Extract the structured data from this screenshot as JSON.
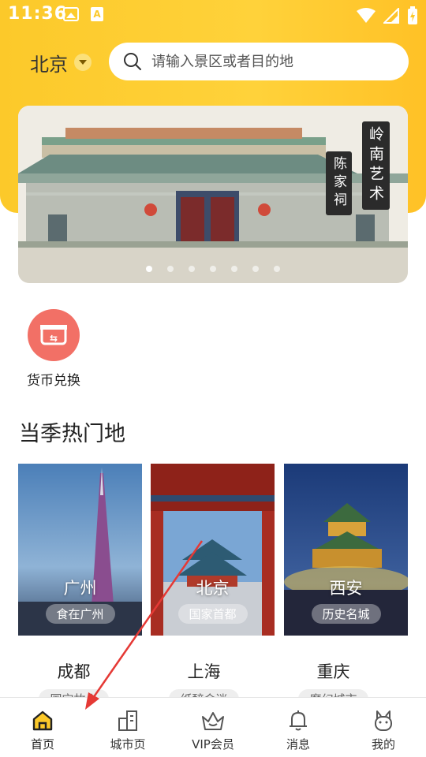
{
  "status_bar": {
    "time": "11:36"
  },
  "header": {
    "city": "北京",
    "search_placeholder": "请输入景区或者目的地"
  },
  "banner": {
    "title_main": "岭南艺术",
    "title_sub": "陈家祠",
    "dot_count": 7,
    "active_dot": 0
  },
  "quick_entries": [
    {
      "label": "货币兑换",
      "icon": "currency-exchange-icon"
    }
  ],
  "section": {
    "title": "当季热门地"
  },
  "destinations": [
    {
      "city": "广州",
      "tag": "食在广州"
    },
    {
      "city": "北京",
      "tag": "国家首都"
    },
    {
      "city": "西安",
      "tag": "历史名城"
    }
  ],
  "destinations_row2": [
    {
      "city": "成都",
      "tag": "国宝故乡"
    },
    {
      "city": "上海",
      "tag": "纸醉金迷"
    },
    {
      "city": "重庆",
      "tag": "魔幻城市"
    }
  ],
  "bottom_nav": [
    {
      "label": "首页",
      "icon": "home-icon",
      "active": true
    },
    {
      "label": "城市页",
      "icon": "city-icon",
      "active": false
    },
    {
      "label": "VIP会员",
      "icon": "crown-icon",
      "active": false
    },
    {
      "label": "消息",
      "icon": "bell-icon",
      "active": false
    },
    {
      "label": "我的",
      "icon": "profile-icon",
      "active": false
    }
  ],
  "colors": {
    "brand_yellow": "#fcc92a",
    "accent_red": "#f27066",
    "annotation_red": "#e53935"
  }
}
